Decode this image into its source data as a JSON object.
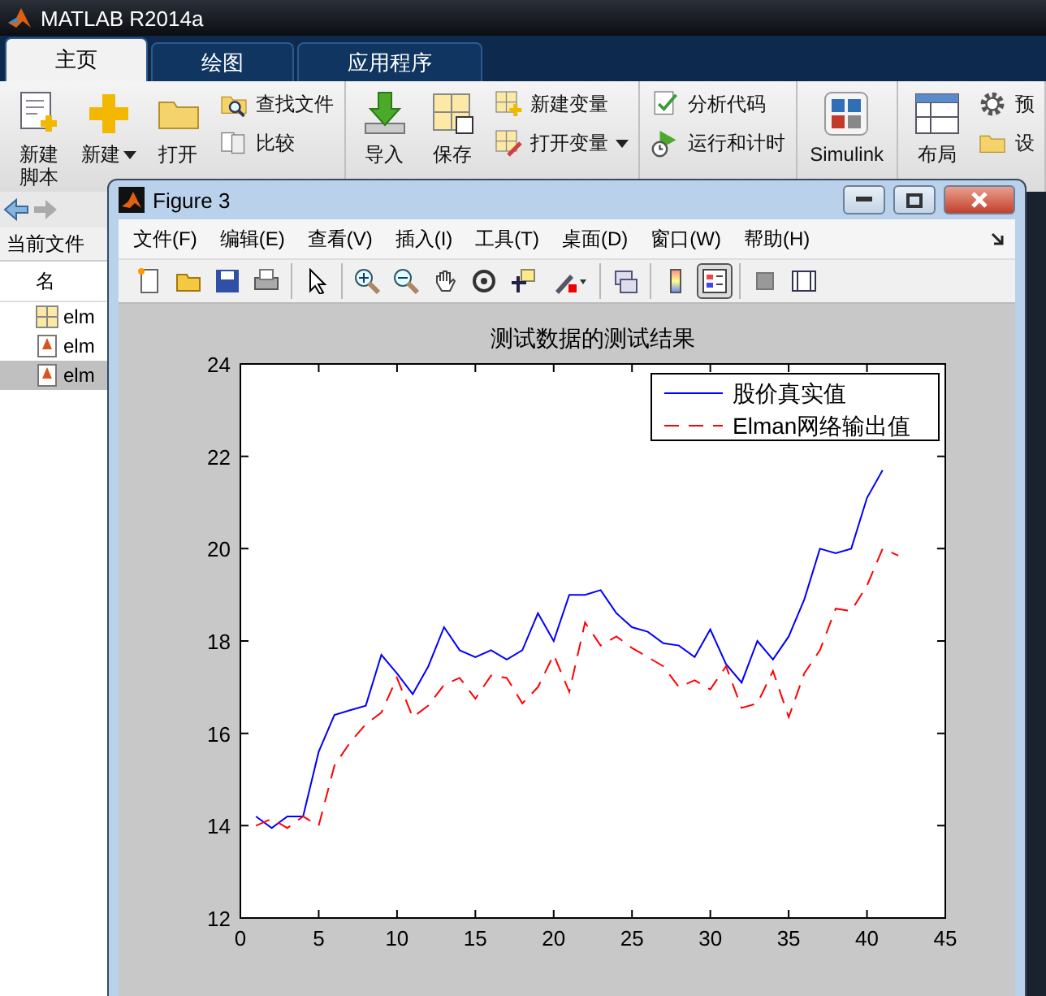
{
  "app": {
    "title": "MATLAB R2014a"
  },
  "tabs": [
    {
      "label": "主页",
      "selected": true
    },
    {
      "label": "绘图",
      "selected": false
    },
    {
      "label": "应用程序",
      "selected": false
    }
  ],
  "ribbon": {
    "groups": [
      {
        "items": [
          {
            "kind": "large",
            "label": "新建脚本",
            "dropdown": false
          },
          {
            "kind": "large",
            "label": "新建",
            "dropdown": true
          },
          {
            "kind": "large",
            "label": "打开",
            "dropdown": false
          },
          {
            "kind": "stack",
            "entries": [
              {
                "label": "查找文件",
                "dropdown": false
              },
              {
                "label": "比较",
                "dropdown": false
              }
            ]
          }
        ]
      },
      {
        "items": [
          {
            "kind": "large",
            "label": "导入",
            "dropdown": false
          },
          {
            "kind": "large",
            "label": "保存",
            "dropdown": false
          },
          {
            "kind": "stack",
            "entries": [
              {
                "label": "新建变量",
                "dropdown": false
              },
              {
                "label": "打开变量",
                "dropdown": true
              }
            ]
          }
        ]
      },
      {
        "items": [
          {
            "kind": "stack",
            "entries": [
              {
                "label": "分析代码",
                "dropdown": false
              },
              {
                "label": "运行和计时",
                "dropdown": false
              }
            ]
          }
        ]
      },
      {
        "items": [
          {
            "kind": "large",
            "label": "Simulink",
            "dropdown": false
          }
        ]
      },
      {
        "items": [
          {
            "kind": "large",
            "label": "布局",
            "dropdown": false
          },
          {
            "kind": "stack",
            "entries": [
              {
                "label": "预",
                "dropdown": false
              },
              {
                "label": "设",
                "dropdown": false
              }
            ]
          }
        ]
      }
    ]
  },
  "file_browser": {
    "path_label": "当前文件",
    "column": "名",
    "files": [
      {
        "name": "elm",
        "selected": false
      },
      {
        "name": "elm",
        "selected": false
      },
      {
        "name": "elm",
        "selected": true
      }
    ]
  },
  "figure": {
    "title": "Figure 3",
    "menu": [
      "文件(F)",
      "编辑(E)",
      "查看(V)",
      "插入(I)",
      "工具(T)",
      "桌面(D)",
      "窗口(W)",
      "帮助(H)"
    ],
    "toolbar": [
      [
        {
          "on": false
        },
        {
          "on": false
        },
        {
          "on": false
        },
        {
          "on": false
        }
      ],
      [
        {
          "on": false
        }
      ],
      [
        {
          "on": false
        },
        {
          "on": false
        },
        {
          "on": false
        },
        {
          "on": false
        },
        {
          "on": false
        },
        {
          "on": false
        }
      ],
      [
        {
          "on": false
        }
      ],
      [
        {
          "on": false
        },
        {
          "on": true
        }
      ],
      [
        {
          "on": false
        },
        {
          "on": false
        }
      ]
    ],
    "chart_data": {
      "type": "line",
      "title": "测试数据的测试结果",
      "x": [
        1,
        2,
        3,
        4,
        5,
        6,
        7,
        8,
        9,
        10,
        11,
        12,
        13,
        14,
        15,
        16,
        17,
        18,
        19,
        20,
        21,
        22,
        23,
        24,
        25,
        26,
        27,
        28,
        29,
        30,
        31,
        32,
        33,
        34,
        35,
        36,
        37,
        38,
        39,
        40,
        41,
        42
      ],
      "series": [
        {
          "name": "股价真实值",
          "color": "#0000ff",
          "line_style": "solid",
          "values": [
            14.2,
            13.95,
            14.2,
            14.2,
            15.6,
            16.4,
            16.5,
            16.6,
            17.7,
            17.3,
            16.85,
            17.45,
            18.3,
            17.8,
            17.65,
            17.8,
            17.6,
            17.8,
            18.6,
            18.0,
            19.0,
            19.0,
            19.1,
            18.6,
            18.3,
            18.2,
            17.95,
            17.9,
            17.65,
            18.25,
            17.5,
            17.1,
            18.0,
            17.6,
            18.1,
            18.9,
            20.0,
            19.9,
            20.0,
            21.1,
            21.7,
            null
          ]
        },
        {
          "name": "Elman网络输出值",
          "color": "#ff0000",
          "line_style": "dashed",
          "values": [
            14.0,
            14.15,
            13.95,
            14.2,
            14.0,
            15.3,
            15.8,
            16.2,
            16.45,
            17.2,
            16.35,
            16.6,
            17.05,
            17.2,
            16.75,
            17.25,
            17.2,
            16.65,
            17.0,
            17.7,
            16.9,
            18.4,
            17.9,
            18.1,
            17.85,
            17.65,
            17.45,
            17.0,
            17.15,
            16.95,
            17.45,
            16.55,
            16.65,
            17.35,
            16.35,
            17.3,
            17.8,
            18.7,
            18.65,
            19.2,
            20.0,
            19.85
          ]
        }
      ],
      "xlim": [
        0,
        45
      ],
      "ylim": [
        12,
        24
      ],
      "xticks": [
        0,
        5,
        10,
        15,
        20,
        25,
        30,
        35,
        40,
        45
      ],
      "yticks": [
        12,
        14,
        16,
        18,
        20,
        22,
        24
      ],
      "legend": true
    }
  }
}
